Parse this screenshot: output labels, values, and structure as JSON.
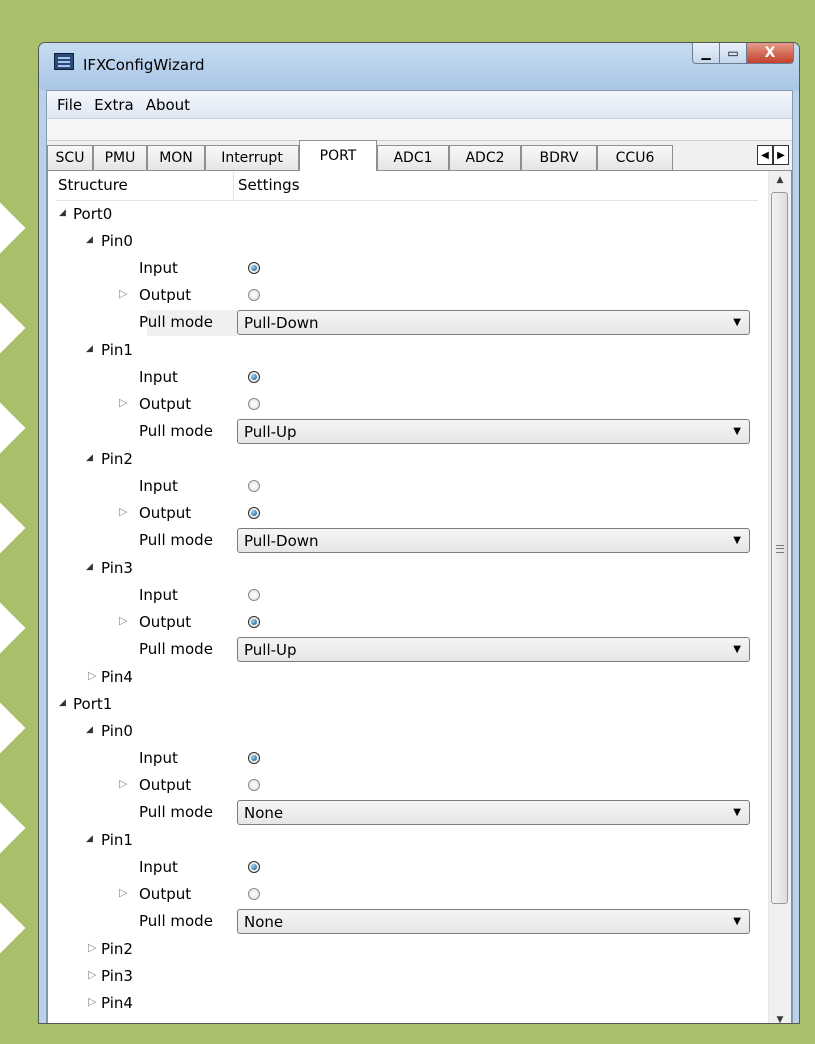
{
  "window": {
    "title": "IFXConfigWizard",
    "minimize_glyph": "▁",
    "maximize_glyph": "▭",
    "close_glyph": "X"
  },
  "menu": [
    "File",
    "Extra",
    "About"
  ],
  "tabs": [
    "SCU",
    "PMU",
    "MON",
    "Interrupt",
    "PORT",
    "ADC1",
    "ADC2",
    "BDRV",
    "CCU6"
  ],
  "active_tab": "PORT",
  "tab_scroll": {
    "left_glyph": "◀",
    "right_glyph": "▶"
  },
  "header": {
    "structure": "Structure",
    "settings": "Settings"
  },
  "tree": {
    "ports": [
      {
        "label": "Port0",
        "pins": [
          {
            "label": "Pin0",
            "input_label": "Input",
            "output_label": "Output",
            "pull_label": "Pull mode",
            "input_selected": true,
            "output_selected": false,
            "pull_mode": "Pull-Down"
          },
          {
            "label": "Pin1",
            "input_label": "Input",
            "output_label": "Output",
            "pull_label": "Pull mode",
            "input_selected": true,
            "output_selected": false,
            "pull_mode": "Pull-Up"
          },
          {
            "label": "Pin2",
            "input_label": "Input",
            "output_label": "Output",
            "pull_label": "Pull mode",
            "input_selected": false,
            "output_selected": true,
            "pull_mode": "Pull-Down"
          },
          {
            "label": "Pin3",
            "input_label": "Input",
            "output_label": "Output",
            "pull_label": "Pull mode",
            "input_selected": false,
            "output_selected": true,
            "pull_mode": "Pull-Up"
          },
          {
            "label": "Pin4"
          }
        ]
      },
      {
        "label": "Port1",
        "pins": [
          {
            "label": "Pin0",
            "input_label": "Input",
            "output_label": "Output",
            "pull_label": "Pull mode",
            "input_selected": true,
            "output_selected": false,
            "pull_mode": "None"
          },
          {
            "label": "Pin1",
            "input_label": "Input",
            "output_label": "Output",
            "pull_label": "Pull mode",
            "input_selected": true,
            "output_selected": false,
            "pull_mode": "None"
          },
          {
            "label": "Pin2"
          },
          {
            "label": "Pin3"
          },
          {
            "label": "Pin4"
          }
        ]
      }
    ]
  },
  "icons": {
    "expanded": "◢",
    "collapsed": "▷",
    "combo_arrow": "▼",
    "scroll_up": "▲",
    "scroll_down": "▼"
  },
  "colors": {
    "background": "#a9c06a",
    "window_frame": "#b9d1ea",
    "close_button": "#c2412c",
    "radio_selected": "#0c4f86"
  }
}
